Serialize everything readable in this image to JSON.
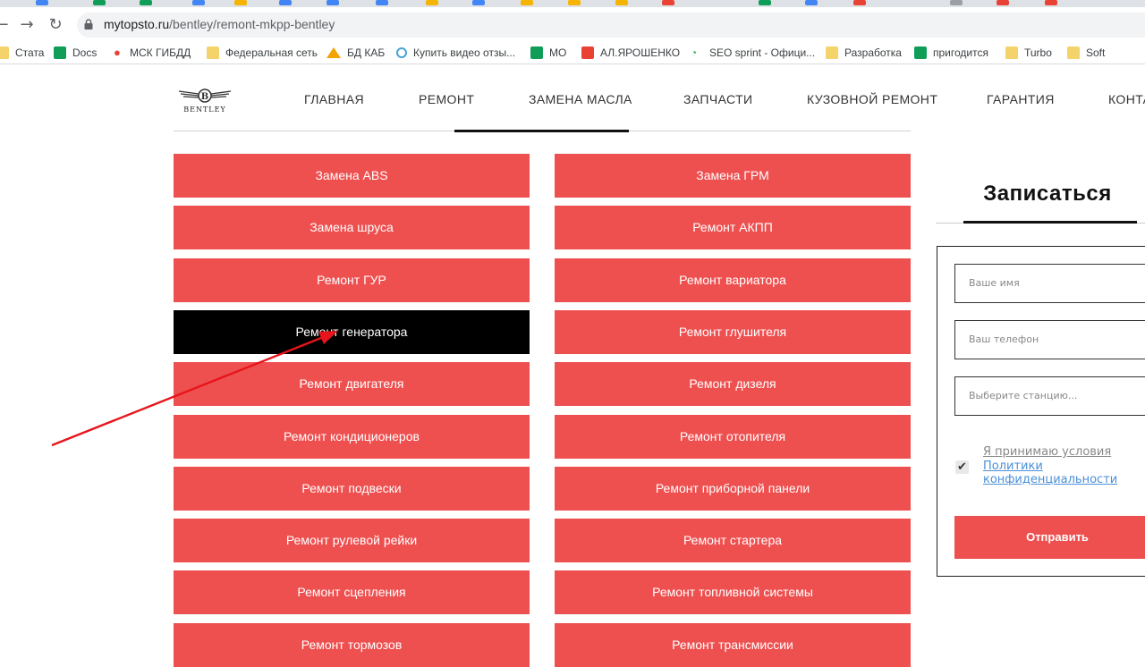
{
  "browser": {
    "url_host": "mytopsto.ru",
    "url_path": "/bentley/remont-mkpp-bentley",
    "bookmarks": [
      {
        "label": "Стата",
        "icon": "folder-icon"
      },
      {
        "label": "Docs",
        "icon": "green-doc-icon"
      },
      {
        "label": "МСК ГИБДД",
        "icon": "map-pin-icon"
      },
      {
        "label": "Федеральная сеть",
        "icon": "folder-icon"
      },
      {
        "label": "БД КАБ",
        "icon": "triangle-logo-icon"
      },
      {
        "label": "Купить видео отзы...",
        "icon": "circle-icon"
      },
      {
        "label": "МО",
        "icon": "green-doc-icon"
      },
      {
        "label": "АЛ.ЯРОШЕНКО",
        "icon": "red-arrow-icon"
      },
      {
        "label": "SEO sprint - Офици...",
        "icon": "seo-icon"
      },
      {
        "label": "Разработка",
        "icon": "folder-icon"
      },
      {
        "label": "пригодится",
        "icon": "green-doc-icon"
      },
      {
        "label": "Turbo",
        "icon": "folder-icon"
      },
      {
        "label": "Soft",
        "icon": "folder-icon"
      }
    ]
  },
  "site": {
    "logo_text": "BENTLEY",
    "menu": [
      "ГЛАВНАЯ",
      "РЕМОНТ",
      "ЗАМЕНА МАСЛА",
      "ЗАПЧАСТИ",
      "КУЗОВНОЙ РЕМОНТ",
      "ГАРАНТИЯ",
      "КОНТА"
    ]
  },
  "services": {
    "left": [
      "Замена ABS",
      "Замена шруса",
      "Ремонт ГУР",
      "Ремонт генератора",
      "Ремонт двигателя",
      "Ремонт кондиционеров",
      "Ремонт подвески",
      "Ремонт рулевой рейки",
      "Ремонт сцепления",
      "Ремонт тормозов"
    ],
    "right": [
      "Замена ГРМ",
      "Ремонт АКПП",
      "Ремонт вариатора",
      "Ремонт глушителя",
      "Ремонт дизеля",
      "Ремонт отопителя",
      "Ремонт приборной панели",
      "Ремонт стартера",
      "Ремонт топливной системы",
      "Ремонт трансмиссии"
    ],
    "active": "Ремонт генератора"
  },
  "signup": {
    "title": "Записаться",
    "name_placeholder": "Ваше имя",
    "phone_placeholder": "Ваш телефон",
    "station_placeholder": "Выберите станцию...",
    "agree_prefix": "Я принимаю условия",
    "agree_link": "Политики конфиденциальности",
    "submit_label": "Отправить",
    "agree_checked": true
  },
  "colors": {
    "accent": "#ee5050",
    "active": "#000000",
    "annotation_arrow": "#e8141b"
  }
}
